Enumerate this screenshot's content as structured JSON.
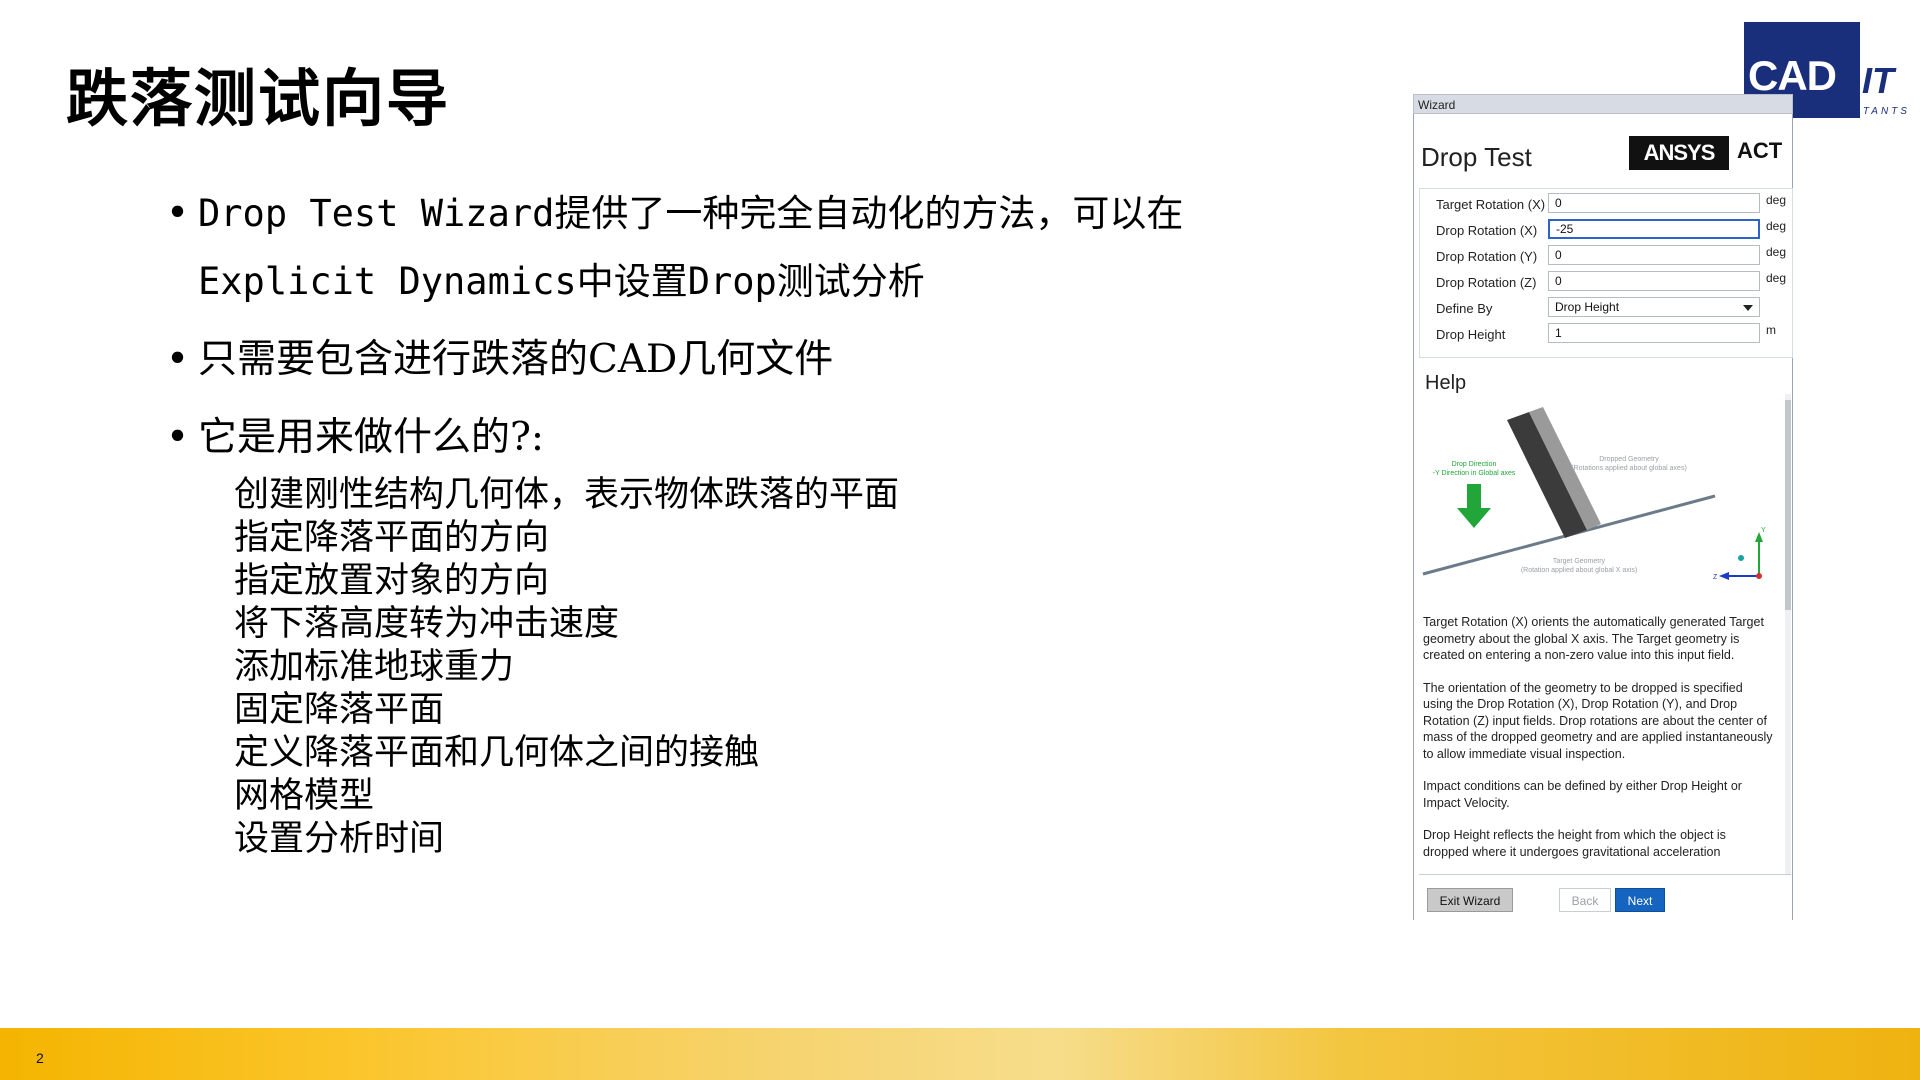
{
  "slide": {
    "title": "跌落测试向导",
    "page_number": "2"
  },
  "logo": {
    "main": "CAD",
    "it": "IT",
    "sub": "CONSULTANTS"
  },
  "bullets": [
    {
      "line1": "Drop Test Wizard提供了一种完全自动化的方法，可以在",
      "line2": "Explicit Dynamics中设置Drop测试分析"
    },
    {
      "line1": "只需要包含进行跌落的CAD几何文件"
    },
    {
      "line1": "它是用来做什么的?:"
    }
  ],
  "sublist": [
    "创建刚性结构几何体，表示物体跌落的平面",
    "指定降落平面的方向",
    "指定放置对象的方向",
    "将下落高度转为冲击速度",
    "添加标准地球重力",
    "固定降落平面",
    "定义降落平面和几何体之间的接触",
    "网格模型",
    "设置分析时间"
  ],
  "wizard": {
    "window_title": "Wizard",
    "title": "Drop Test",
    "ansys": "ANSYS",
    "act": "ACT",
    "fields": [
      {
        "label": "Target Rotation (X)",
        "value": "0",
        "unit": "deg"
      },
      {
        "label": "Drop Rotation (X)",
        "value": "-25",
        "unit": "deg"
      },
      {
        "label": "Drop Rotation (Y)",
        "value": "0",
        "unit": "deg"
      },
      {
        "label": "Drop Rotation (Z)",
        "value": "0",
        "unit": "deg"
      },
      {
        "label": "Define By",
        "value": "Drop Height",
        "unit": ""
      },
      {
        "label": "Drop Height",
        "value": "1",
        "unit": "m"
      }
    ],
    "help_title": "Help",
    "diagram": {
      "drop_direction": "Drop Direction",
      "drop_direction_sub": "-Y Direction in Global axes",
      "dropped_geometry": "Dropped Geometry",
      "dropped_geometry_sub": "(Rotations applied about global axes)",
      "target_geometry": "Target Geometry",
      "target_geometry_sub": "(Rotation applied about global X axis)",
      "axis_y": "Y",
      "axis_z": "Z"
    },
    "help_paragraphs": [
      "Target Rotation (X) orients the automatically generated Target geometry about the global X axis. The Target geometry is created on entering a non-zero value into this input field.",
      "The orientation of the geometry to be dropped is specified using the Drop Rotation (X), Drop Rotation (Y), and Drop Rotation (Z) input fields. Drop rotations are about the center of mass of the dropped geometry and are applied instantaneously to allow immediate visual inspection.",
      "Impact conditions can be defined by either Drop Height or Impact Velocity.",
      "Drop Height reflects the height from which the object is dropped where it undergoes gravitational acceleration"
    ],
    "buttons": {
      "exit": "Exit Wizard",
      "back": "Back",
      "next": "Next"
    },
    "colors": {
      "accent": "#1565c0",
      "arrow": "#22a63a",
      "logo": "#1a2f7c"
    }
  }
}
